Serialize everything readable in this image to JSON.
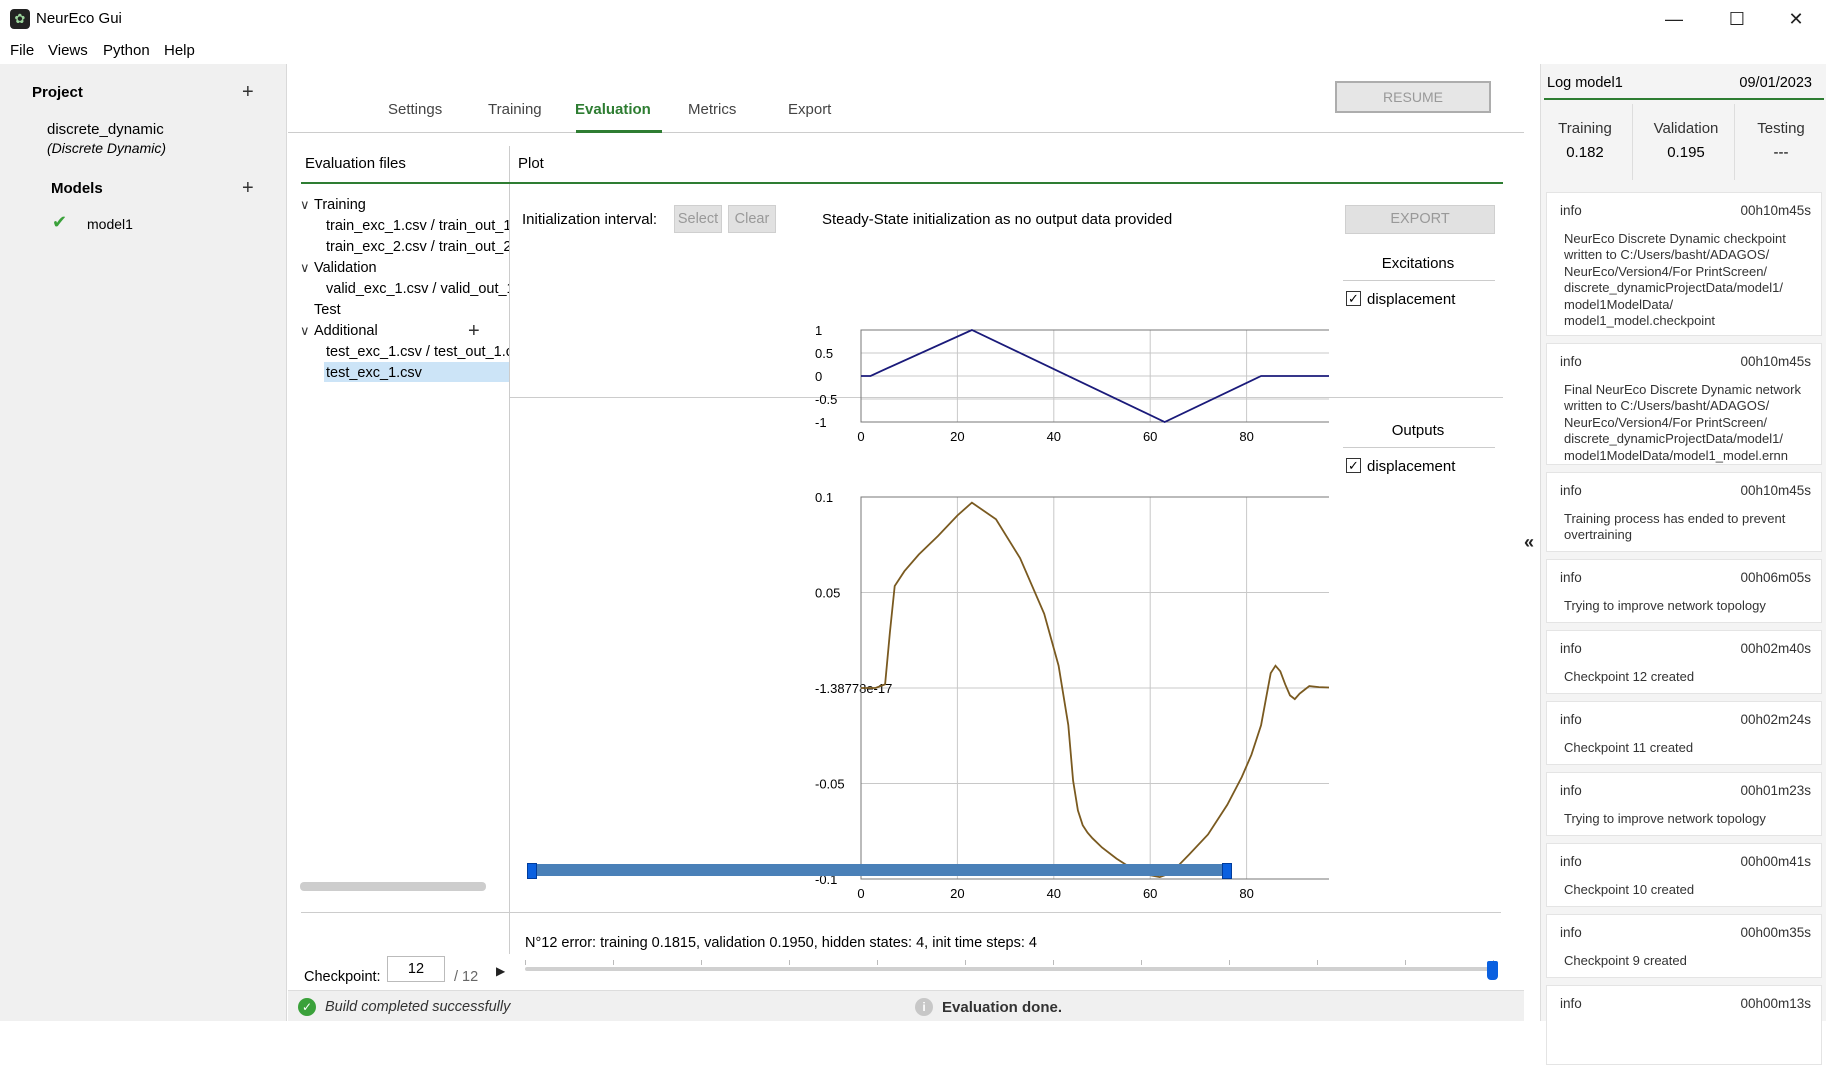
{
  "window": {
    "title": "NeurEco Gui",
    "minimize": "—",
    "maximize": "☐",
    "close": "✕"
  },
  "menu": [
    "File",
    "Views",
    "Python",
    "Help"
  ],
  "left": {
    "project_header": "Project",
    "project_name": "discrete_dynamic",
    "project_type": "(Discrete Dynamic)",
    "models_header": "Models",
    "model_check": "✔",
    "model_name": "model1"
  },
  "tabs": [
    "Settings",
    "Training",
    "Evaluation",
    "Metrics",
    "Export"
  ],
  "active_tab": "Evaluation",
  "resume_label": "RESUME",
  "eval_files": {
    "header": "Evaluation files",
    "training": "Training",
    "training_files": [
      "train_exc_1.csv / train_out_1.csv",
      "train_exc_2.csv / train_out_2.csv"
    ],
    "validation": "Validation",
    "validation_files": [
      "valid_exc_1.csv / valid_out_1.csv"
    ],
    "test": "Test",
    "additional": "Additional",
    "additional_files": [
      "test_exc_1.csv / test_out_1.csv",
      "test_exc_1.csv"
    ]
  },
  "plot": {
    "header": "Plot",
    "init_label": "Initialization interval:",
    "select_label": "Select",
    "clear_label": "Clear",
    "note": "Steady-State initialization as no output data provided",
    "export_label": "EXPORT",
    "excitations_header": "Excitations",
    "excitations_item": "displacement",
    "outputs_header": "Outputs",
    "outputs_item": "displacement",
    "check": "✓"
  },
  "chart_data": [
    {
      "type": "line",
      "series": [
        {
          "name": "displacement",
          "x": [
            0,
            2,
            4,
            23,
            63,
            83,
            150
          ],
          "y": [
            0,
            0,
            0.1,
            1,
            -1,
            0,
            0
          ]
        }
      ],
      "xlim": [
        0,
        150
      ],
      "ylim": [
        -1,
        1
      ],
      "xticks": [
        "0",
        "20",
        "40",
        "60",
        "80",
        "100",
        "120",
        "140"
      ],
      "yticks": [
        "1",
        "0.5",
        "0",
        "-0.5",
        "-1"
      ],
      "legend": "top-right",
      "grid": true,
      "color": "#1a1a7a"
    },
    {
      "type": "line",
      "series": [
        {
          "name": "displacement_prediction",
          "x": [
            0,
            3,
            5,
            6,
            7,
            9,
            12,
            16,
            20,
            23,
            28,
            33,
            38,
            41,
            43,
            44,
            45,
            46,
            47,
            48,
            50,
            53,
            56,
            58,
            60,
            62,
            63,
            65,
            68,
            72,
            76,
            79,
            81,
            83,
            84,
            85,
            86,
            87,
            88,
            89,
            90,
            91,
            92,
            93,
            95,
            100,
            120,
            150
          ],
          "y": [
            0,
            0,
            0.002,
            0.03,
            0.055,
            0.063,
            0.072,
            0.082,
            0.093,
            0.1,
            0.091,
            0.07,
            0.04,
            0.012,
            -0.02,
            -0.05,
            -0.066,
            -0.074,
            -0.078,
            -0.081,
            -0.086,
            -0.092,
            -0.097,
            -0.1,
            -0.101,
            -0.102,
            -0.101,
            -0.098,
            -0.09,
            -0.079,
            -0.063,
            -0.048,
            -0.036,
            -0.02,
            -0.006,
            0.008,
            0.012,
            0.009,
            0.002,
            -0.004,
            -0.006,
            -0.003,
            -0.001,
            0.001,
            0.0005,
            0,
            0,
            0
          ]
        }
      ],
      "xlim": [
        0,
        150
      ],
      "ylim": [
        -0.103,
        0.103
      ],
      "xticks": [
        "0",
        "20",
        "40",
        "60",
        "80",
        "100",
        "120",
        "140"
      ],
      "yticks": [
        "0.1",
        "0.05",
        "-1.38778e-17",
        "-0.05",
        "-0.1"
      ],
      "legend": "top-right",
      "grid": true,
      "color": "#7a5a20"
    }
  ],
  "range_slider": {
    "start": 0,
    "end": 1
  },
  "checkpoint": {
    "info": "N°12 error: training 0.1815, validation 0.1950, hidden states: 4, init time steps: 4",
    "label": "Checkpoint:",
    "value": "12",
    "total": "/ 12",
    "play": "▶",
    "position_fraction": 1.0
  },
  "status": {
    "build": "Build completed successfully",
    "eval": "Evaluation done.",
    "build_icon": "✓",
    "eval_icon": "i"
  },
  "collapse_icon": "«",
  "log": {
    "title": "Log model1",
    "date": "09/01/2023",
    "metrics": [
      {
        "name": "Training",
        "value": "0.182"
      },
      {
        "name": "Validation",
        "value": "0.195"
      },
      {
        "name": "Testing",
        "value": "---"
      }
    ],
    "entries": [
      {
        "level": "info",
        "time": "00h10m45s",
        "msg": "NeurEco Discrete Dynamic checkpoint written to C:/Users/basht/ADAGOS/ NeurEco/Version4/For PrintScreen/ discrete_dynamicProjectData/model1/ model1ModelData/ model1_model.checkpoint"
      },
      {
        "level": "info",
        "time": "00h10m45s",
        "msg": "Final NeurEco Discrete Dynamic network written to C:/Users/basht/ADAGOS/ NeurEco/Version4/For PrintScreen/ discrete_dynamicProjectData/model1/ model1ModelData/model1_model.ernn"
      },
      {
        "level": "info",
        "time": "00h10m45s",
        "msg": "Training process has ended to prevent overtraining"
      },
      {
        "level": "info",
        "time": "00h06m05s",
        "msg": "Trying to improve network topology"
      },
      {
        "level": "info",
        "time": "00h02m40s",
        "msg": "Checkpoint 12 created"
      },
      {
        "level": "info",
        "time": "00h02m24s",
        "msg": "Checkpoint 11 created"
      },
      {
        "level": "info",
        "time": "00h01m23s",
        "msg": "Trying to improve network topology"
      },
      {
        "level": "info",
        "time": "00h00m41s",
        "msg": "Checkpoint 10 created"
      },
      {
        "level": "info",
        "time": "00h00m35s",
        "msg": "Checkpoint 9 created"
      },
      {
        "level": "info",
        "time": "00h00m13s",
        "msg": ""
      }
    ]
  }
}
